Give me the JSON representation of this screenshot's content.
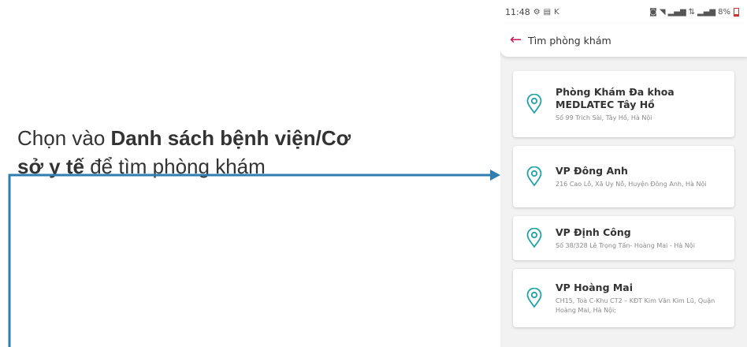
{
  "instruction": {
    "line1_prefix": "Chọn vào ",
    "line1_bold": "Danh sách bệnh viện/Cơ",
    "line2_bold": "sở y tế",
    "line2_suffix": " để tìm phòng khám"
  },
  "status_bar": {
    "time": "11:48",
    "left_icons": [
      "settings-gear-icon",
      "message-icon",
      "k-app-icon"
    ],
    "right_icons": [
      "mute-icon",
      "wifi-icon",
      "signal-icon",
      "signal-4g-icon",
      "signal-icon"
    ],
    "battery": "8%"
  },
  "header": {
    "back_icon": "arrow-left-icon",
    "title": "Tìm phòng khám"
  },
  "clinics": [
    {
      "name": "Phòng Khám Đa khoa MEDLATEC Tây Hồ",
      "address": "Số 99 Trích Sài, Tây Hồ, Hà Nội"
    },
    {
      "name": "VP Đông Anh",
      "address": "216 Cao Lỗ, Xã Uy Nỗ, Huyện Đông Anh, Hà Nội"
    },
    {
      "name": "VP Định Công",
      "address": "Số 38/328 Lê Trọng Tấn- Hoàng Mai - Hà Nội"
    },
    {
      "name": "VP Hoàng Mai",
      "address": "CH15, Toà C-Khu CT2 – KĐT Kim Văn Kim Lũ, Quận Hoàng Mai, Hà Nội;"
    }
  ],
  "colors": {
    "accent": "#c2185b",
    "pin": "#1fa3a8",
    "connector": "#2e7eb0"
  }
}
